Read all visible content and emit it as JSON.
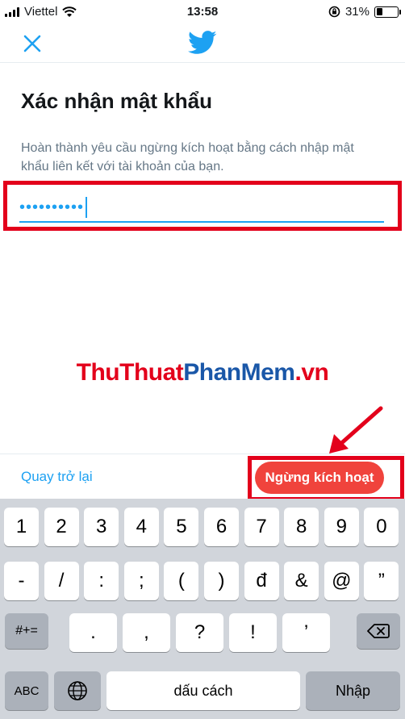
{
  "status": {
    "carrier": "Viettel",
    "time": "13:58",
    "battery": "31%",
    "battery_level": 0.31
  },
  "nav": {
    "close_icon": "close-icon",
    "logo_icon": "twitter-bird-icon"
  },
  "page": {
    "title": "Xác nhận mật khẩu",
    "description": "Hoàn thành yêu cầu ngừng kích hoạt bằng cách nhập mật khẩu liên kết với tài khoản của bạn.",
    "password_masked": "••••••••••"
  },
  "watermark": {
    "part1": "ThuThuat",
    "part2": "PhanMem",
    "part3": ".vn"
  },
  "actions": {
    "back_label": "Quay trở lại",
    "deactivate_label": "Ngừng kích hoạt"
  },
  "keyboard": {
    "row1": [
      "1",
      "2",
      "3",
      "4",
      "5",
      "6",
      "7",
      "8",
      "9",
      "0"
    ],
    "row2": [
      "-",
      "/",
      ":",
      ";",
      "(",
      ")",
      "đ",
      "&",
      "@",
      "”"
    ],
    "row3_left": "#+=",
    "row3": [
      ".",
      ",",
      "?",
      "!",
      "’"
    ],
    "mode_label": "ABC",
    "space_label": "dấu cách",
    "return_label": "Nhập"
  },
  "colors": {
    "twitter_blue": "#1da1f2",
    "highlight_red": "#e3001b",
    "button_red": "#f0433c"
  }
}
